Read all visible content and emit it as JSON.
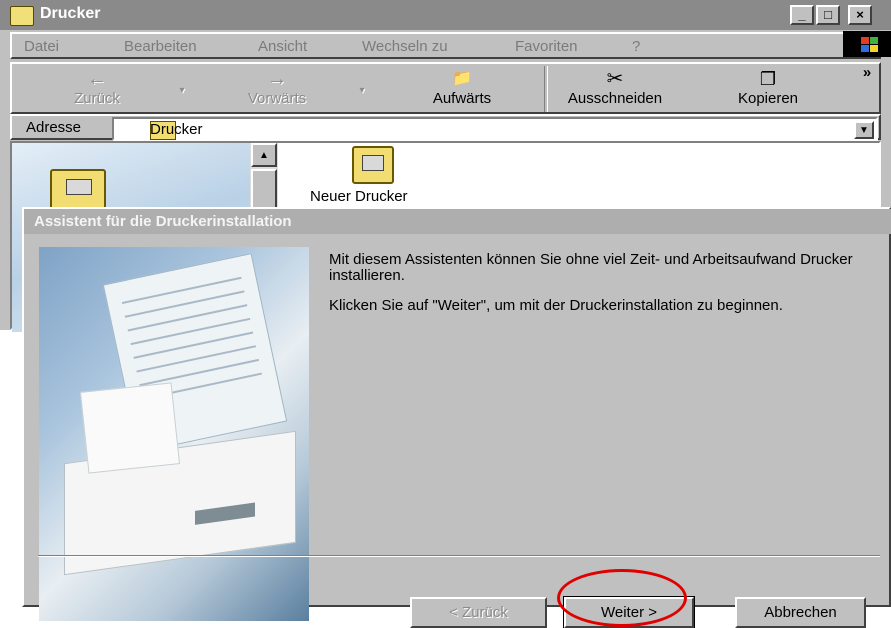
{
  "window": {
    "title": "Drucker",
    "controls": [
      "_",
      "□",
      "×"
    ]
  },
  "menubar": {
    "items": [
      "Datei",
      "Bearbeiten",
      "Ansicht",
      "Wechseln zu",
      "Favoriten",
      "?"
    ]
  },
  "toolbar": {
    "back_label": "Zurück",
    "forward_label": "Vorwärts",
    "up_label": "Aufwärts",
    "cut_label": "Ausschneiden",
    "copy_label": "Kopieren",
    "more_label": "»"
  },
  "address_bar": {
    "label": "Adresse",
    "value": "Drucker"
  },
  "content": {
    "items": [
      {
        "label": "Neuer Drucker",
        "icon": "add-printer-icon"
      }
    ]
  },
  "wizard": {
    "title": "Assistent für die Druckerinstallation",
    "paragraph1": "Mit diesem Assistenten können Sie ohne viel Zeit- und Arbeitsaufwand Drucker installieren.",
    "paragraph2": "Klicken Sie auf \"Weiter\", um mit der Druckerinstallation zu beginnen.",
    "back_button": "< Zurück",
    "next_button": "Weiter >",
    "cancel_button": "Abbrechen"
  },
  "colors": {
    "highlight": "#e00000",
    "titlebar": "#8a8a8a",
    "window_bg": "#c0c0c0"
  }
}
